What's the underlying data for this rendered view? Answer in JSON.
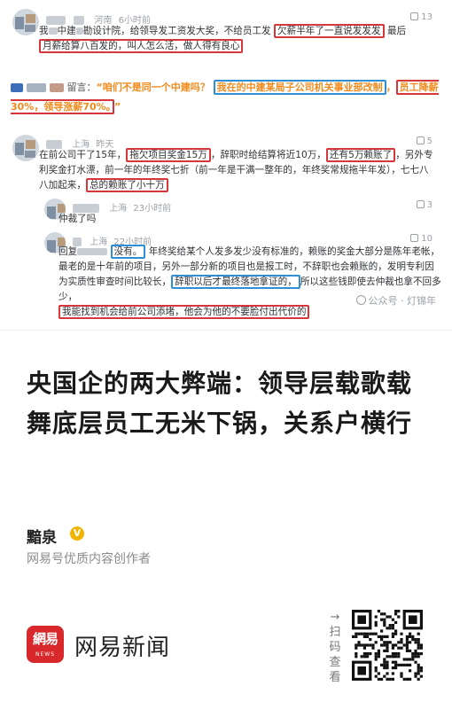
{
  "comments": [
    {
      "location": "河南",
      "time": "6小时前",
      "likes": "13",
      "prefix": "我",
      "t1": "中建",
      "t2": "勘设计院，给领导发工资发大奖，不给员工发",
      "boxed": "欠薪半年了一直说发发发",
      "t3": "最后",
      "boxed2": "月薪给算八百发的，叫人怎么活，做人得有良心"
    },
    {
      "t_label": "留言：",
      "quote_open": "“咱们不是同一个中建吗？",
      "boxed_blue": "我在的中建某局子公司机关事业部改制",
      "sep": "，",
      "boxed_red": "员工降薪30%，领导涨薪70%。",
      "quote_close": "”"
    },
    {
      "location": "上海",
      "time": "昨天",
      "likes": "5",
      "t1": "在前公司干了15年，",
      "boxed1": "拖欠项目奖金15万",
      "t2": "，辞职时给结算将近10万，",
      "boxed2": "还有5万赖账了",
      "t3": "，另外专利奖金打水漂，前一年的年终奖七折（前一年是干满一整年的，年终奖常规拖半年发），七七八八加起来，",
      "boxed3": "总的赖账了小十万"
    },
    {
      "location": "上海",
      "time": "23小时前",
      "likes": "3",
      "text": "仲裁了吗"
    },
    {
      "location": "上海",
      "time": "22小时前",
      "likes": "10",
      "t_reply": "回复",
      "boxed_blue1": "没有。",
      "t1": "年终奖给某个人发多发少没有标准的，赖账的奖金大部分是陈年老帐，最老的是十年前的项目，另外一部分新的项目也是报工时，不辞职也会赖账的，发明专利因为实质性审查时间比较长，",
      "boxed_blue2": "辞职以后才最终落地拿证的，",
      "t2": "所以这些钱即使去仲裁也拿不回多少，",
      "boxed_red": "我能找到机会给前公司添堵，他会为他的不要脸付出代价的"
    }
  ],
  "watermark": "公众号 · 灯锦年",
  "article": {
    "headline": "央国企的两大弊端：领导层载歌载舞底层员工无米下锅，关系户横行",
    "author": "黯泉",
    "author_badge": "V",
    "author_desc": "网易号优质内容创作者"
  },
  "footer": {
    "logo_main": "網易",
    "logo_sub": "NEWS",
    "brand": "网易新闻",
    "scan_arrow": "→",
    "scan_text": [
      "扫",
      "码",
      "查",
      "看"
    ]
  },
  "colors": {
    "red_box": "#d7363b",
    "blue_box": "#2e8fd6",
    "orange_quote": "#f08a1c",
    "netease_red": "#d8282c",
    "badge_gold": "#f2b300"
  },
  "icons": [
    "avatar",
    "like-thumb-icon",
    "verified-badge-icon",
    "wechat-official-icon",
    "qr-code"
  ]
}
